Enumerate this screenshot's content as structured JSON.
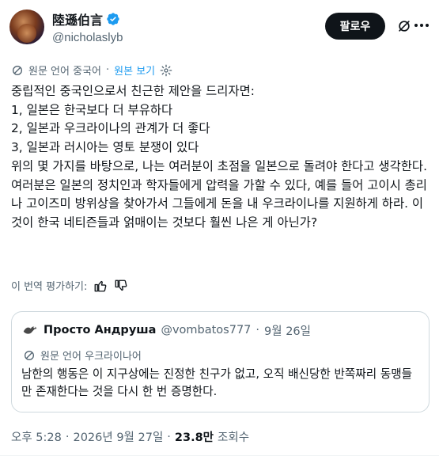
{
  "author": {
    "display_name": "陸遜伯言",
    "handle": "@nicholaslyb"
  },
  "actions": {
    "follow_label": "팔로우"
  },
  "translation_bar": {
    "source_label": "원문 언어 중국어",
    "show_original_label": "원본 보기"
  },
  "tweet": {
    "text": "중립적인 중국인으로서 친근한 제안을 드리자면:\n1, 일본은 한국보다 더 부유하다\n2, 일본과 우크라이나의 관계가 더 좋다\n3, 일본과 러시아는 영토 분쟁이 있다\n위의 몇 가지를 바탕으로, 나는 여러분이 초점을 일본으로 돌려야 한다고 생각한다. 여러분은 일본의 정치인과 학자들에게 압력을 가할 수 있다, 예를 들어 고이시 총리나 고이즈미 방위상을 찾아가서 그들에게 돈을 내 우크라이나를 지원하게 하라. 이것이 한국 네티즌들과 얽매이는 것보다 훨씬 나은 게 아닌가?"
  },
  "rate_translation": {
    "label": "이 번역 평가하기:"
  },
  "quote": {
    "name": "Просто Андруша",
    "handle": "@vombatos777",
    "separator": "·",
    "date": "9월 26일",
    "translation_label": "원문 언어 우크라이나어",
    "text": "남한의 행동은 이 지구상에는 진정한 친구가 없고, 오직 배신당한 반쪽짜리 동맹들만 존재한다는 것을 다시 한 번 증명한다."
  },
  "footer": {
    "time": "오후 5:28",
    "sep1": "·",
    "date": "2026년 9월 27일",
    "sep2": "·",
    "views": "23.8만",
    "views_label": "조회수"
  },
  "colors": {
    "accent": "#1d9bf0",
    "text": "#0f1419",
    "secondary": "#536471",
    "border": "#cfd9de"
  },
  "icons": [
    "verified-badge-icon",
    "grok-icon",
    "more-icon",
    "translate-icon",
    "gear-icon",
    "thumbs-up-icon",
    "thumbs-down-icon"
  ]
}
